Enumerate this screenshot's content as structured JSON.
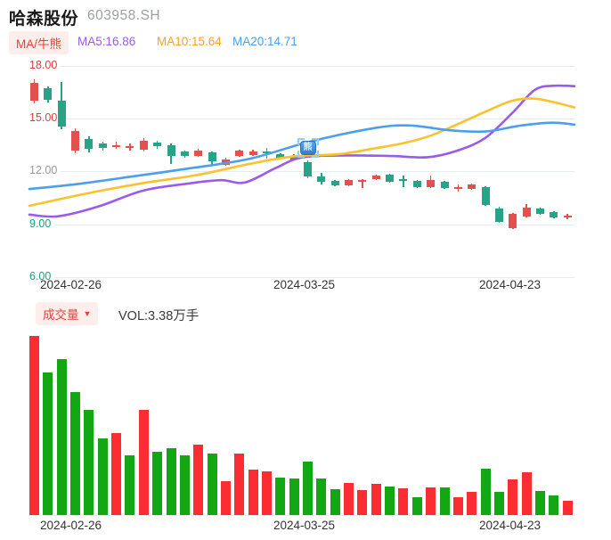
{
  "header": {
    "title": "哈森股份",
    "code": "603958.SH"
  },
  "legend": {
    "indicator_label": "MA/牛熊",
    "ma5": "MA5:16.86",
    "ma10": "MA10:15.64",
    "ma20": "MA20:14.71"
  },
  "volume_header": {
    "label": "成交量",
    "dropdown_icon": "▼",
    "vol_text": "VOL:3.38万手"
  },
  "colors": {
    "candle_up": "#e4504b",
    "candle_down": "#27a488",
    "volume_up": "#fb2d32",
    "volume_down": "#13a813",
    "ma5": "#9a5bea",
    "ma10": "#fcc22d",
    "ma20": "#4d9fec",
    "label_red": "#e23b3b",
    "label_gray": "#999999",
    "label_green": "#19a07c",
    "grid": "#e4ebf3"
  },
  "chart_data": {
    "type": "candlestick+volume",
    "title": "哈森股份 603958.SH",
    "y_axis": {
      "range": [
        6,
        18
      ],
      "ticks": [
        {
          "label": "18.00",
          "color": "#e23b3b"
        },
        {
          "label": "15.00",
          "color": "#e23b3b"
        },
        {
          "label": "12.00",
          "color": "#999999"
        },
        {
          "label": "9.00",
          "color": "#19a07c"
        },
        {
          "label": "6.00",
          "color": "#19a07c"
        }
      ]
    },
    "x_ticks": [
      {
        "label": "2024-02-26",
        "x": 45
      },
      {
        "label": "2024-03-25",
        "x": 307
      },
      {
        "label": "2024-04-23",
        "x": 538
      }
    ],
    "candles": [
      [
        15.98,
        17.04,
        17.2,
        15.84
      ],
      [
        16.7,
        16.05,
        16.82,
        15.9
      ],
      [
        16.0,
        14.55,
        17.05,
        14.4
      ],
      [
        13.16,
        14.3,
        14.42,
        13.04
      ],
      [
        13.82,
        13.3,
        14.0,
        13.08
      ],
      [
        13.6,
        13.35,
        13.68,
        13.2
      ],
      [
        13.42,
        13.48,
        13.68,
        13.27
      ],
      [
        13.38,
        13.44,
        13.58,
        13.2
      ],
      [
        13.25,
        13.73,
        13.87,
        13.15
      ],
      [
        13.65,
        13.41,
        13.72,
        13.3
      ],
      [
        13.5,
        12.86,
        13.58,
        12.4
      ],
      [
        13.11,
        12.86,
        13.18,
        12.75
      ],
      [
        12.89,
        13.2,
        13.28,
        12.8
      ],
      [
        13.08,
        12.57,
        13.15,
        12.39
      ],
      [
        12.39,
        12.66,
        12.75,
        12.3
      ],
      [
        12.87,
        13.17,
        13.25,
        12.8
      ],
      [
        12.91,
        13.15,
        13.25,
        12.85
      ],
      [
        13.12,
        13.08,
        13.31,
        12.7
      ],
      [
        12.98,
        12.77,
        13.05,
        12.7
      ],
      [
        12.89,
        12.66,
        12.95,
        12.6
      ],
      [
        12.52,
        11.73,
        12.6,
        11.6
      ],
      [
        11.73,
        11.42,
        11.9,
        11.26
      ],
      [
        11.45,
        11.22,
        11.52,
        11.15
      ],
      [
        11.2,
        11.5,
        11.56,
        11.14
      ],
      [
        11.4,
        11.5,
        11.55,
        11.06
      ],
      [
        11.55,
        11.75,
        11.8,
        11.5
      ],
      [
        11.8,
        11.41,
        11.86,
        11.35
      ],
      [
        11.54,
        11.48,
        11.75,
        11.13
      ],
      [
        11.46,
        11.13,
        11.52,
        11.08
      ],
      [
        11.13,
        11.49,
        11.75,
        11.08
      ],
      [
        11.41,
        11.04,
        11.47,
        10.98
      ],
      [
        11.05,
        11.11,
        11.26,
        10.84
      ],
      [
        10.99,
        11.26,
        11.3,
        10.95
      ],
      [
        11.1,
        10.1,
        11.18,
        10.05
      ],
      [
        9.88,
        9.14,
        9.98,
        9.08
      ],
      [
        8.78,
        9.59,
        9.65,
        8.75
      ],
      [
        9.42,
        9.93,
        10.15,
        9.38
      ],
      [
        9.88,
        9.59,
        9.93,
        9.55
      ],
      [
        9.71,
        9.37,
        9.76,
        9.32
      ],
      [
        9.39,
        9.51,
        9.6,
        9.3
      ]
    ],
    "ma_lines": [
      {
        "name": "MA5",
        "value": 16.86,
        "color": "#9a5bea",
        "points": [
          [
            33,
            9.55
          ],
          [
            65,
            9.45
          ],
          [
            110,
            10.0
          ],
          [
            160,
            10.9
          ],
          [
            210,
            11.3
          ],
          [
            248,
            11.5
          ],
          [
            275,
            11.37
          ],
          [
            310,
            12.2
          ],
          [
            340,
            12.8
          ],
          [
            390,
            12.9
          ],
          [
            440,
            12.87
          ],
          [
            480,
            12.8
          ],
          [
            515,
            13.2
          ],
          [
            545,
            13.9
          ],
          [
            575,
            15.3
          ],
          [
            600,
            16.6
          ],
          [
            620,
            16.85
          ],
          [
            645,
            16.83
          ]
        ]
      },
      {
        "name": "MA10",
        "value": 15.64,
        "color": "#fcc22d",
        "points": [
          [
            33,
            10.05
          ],
          [
            100,
            10.77
          ],
          [
            160,
            11.33
          ],
          [
            220,
            11.78
          ],
          [
            280,
            12.42
          ],
          [
            330,
            12.85
          ],
          [
            380,
            12.97
          ],
          [
            420,
            13.3
          ],
          [
            455,
            13.62
          ],
          [
            485,
            14.05
          ],
          [
            515,
            14.7
          ],
          [
            545,
            15.38
          ],
          [
            575,
            16.0
          ],
          [
            600,
            16.12
          ],
          [
            625,
            15.88
          ],
          [
            645,
            15.62
          ]
        ]
      },
      {
        "name": "MA20",
        "value": 14.71,
        "color": "#4d9fec",
        "points": [
          [
            33,
            11.0
          ],
          [
            90,
            11.3
          ],
          [
            150,
            11.72
          ],
          [
            210,
            12.15
          ],
          [
            280,
            12.71
          ],
          [
            347,
            13.67
          ],
          [
            420,
            14.45
          ],
          [
            460,
            14.6
          ],
          [
            505,
            14.33
          ],
          [
            545,
            14.26
          ],
          [
            585,
            14.6
          ],
          [
            620,
            14.76
          ],
          [
            645,
            14.65
          ]
        ]
      }
    ],
    "volume": {
      "unit": "万手",
      "latest": 3.38,
      "values": [
        42.5,
        33.8,
        37.0,
        29.2,
        24.9,
        18.2,
        19.4,
        14.2,
        24.9,
        15.0,
        15.8,
        14.2,
        16.7,
        14.6,
        8.0,
        14.6,
        10.8,
        10.4,
        8.9,
        8.7,
        12.7,
        8.7,
        6.1,
        7.6,
        5.9,
        7.4,
        6.8,
        6.3,
        4.2,
        6.5,
        6.5,
        4.2,
        5.5,
        11.0,
        5.5,
        8.5,
        10.1,
        5.7,
        4.6,
        3.38
      ],
      "colors": [
        "r",
        "g",
        "g",
        "g",
        "g",
        "g",
        "r",
        "g",
        "r",
        "g",
        "g",
        "g",
        "r",
        "g",
        "r",
        "r",
        "r",
        "r",
        "g",
        "g",
        "g",
        "g",
        "g",
        "r",
        "r",
        "r",
        "g",
        "r",
        "g",
        "r",
        "g",
        "r",
        "r",
        "g",
        "g",
        "r",
        "r",
        "g",
        "g",
        "r"
      ]
    },
    "marker": {
      "glyph": "熊",
      "candle_index": 20
    }
  }
}
